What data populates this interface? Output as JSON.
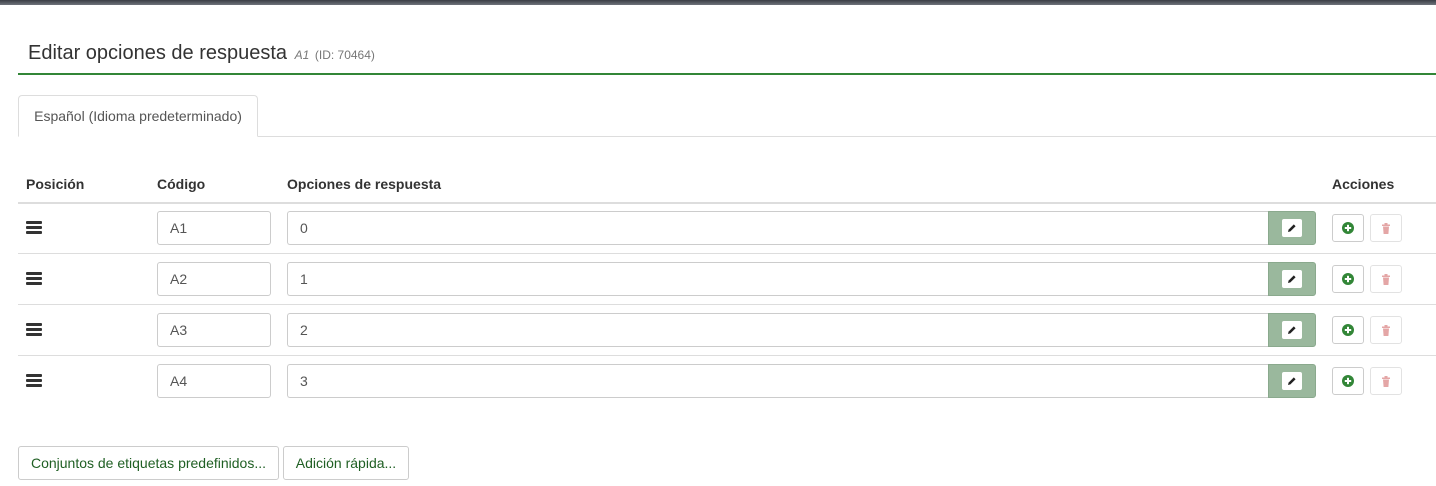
{
  "header": {
    "title": "Editar opciones de respuesta",
    "question_code": "A1",
    "question_id": "(ID: 70464)"
  },
  "tabs": [
    {
      "label": "Español (Idioma predeterminado)"
    }
  ],
  "table": {
    "columns": [
      "Posición",
      "Código",
      "Opciones de respuesta",
      "Acciones"
    ],
    "rows": [
      {
        "code": "A1",
        "answer": "0"
      },
      {
        "code": "A2",
        "answer": "1"
      },
      {
        "code": "A3",
        "answer": "2"
      },
      {
        "code": "A4",
        "answer": "3"
      }
    ]
  },
  "buttons": {
    "predefined_label_sets": "Conjuntos de etiquetas predefinidos...",
    "quick_add": "Adición rápida..."
  },
  "icons": {
    "drag_handle": "drag-handle-icon",
    "edit": "pencil-icon",
    "add": "plus-circle-icon",
    "delete": "trash-icon"
  },
  "colors": {
    "accent_green": "#328637",
    "edit_button_bg": "#9ab89d",
    "delete_icon": "#e4a6a6"
  }
}
